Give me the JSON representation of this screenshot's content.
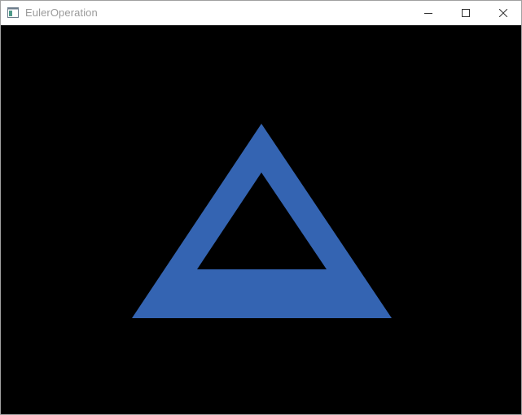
{
  "window": {
    "title": "EulerOperation"
  },
  "caption_buttons": {
    "minimize": "minimize-icon",
    "maximize": "maximize-icon",
    "close": "close-icon"
  },
  "viewport": {
    "background_color": "#000000",
    "shape_color": "#3464b2"
  }
}
